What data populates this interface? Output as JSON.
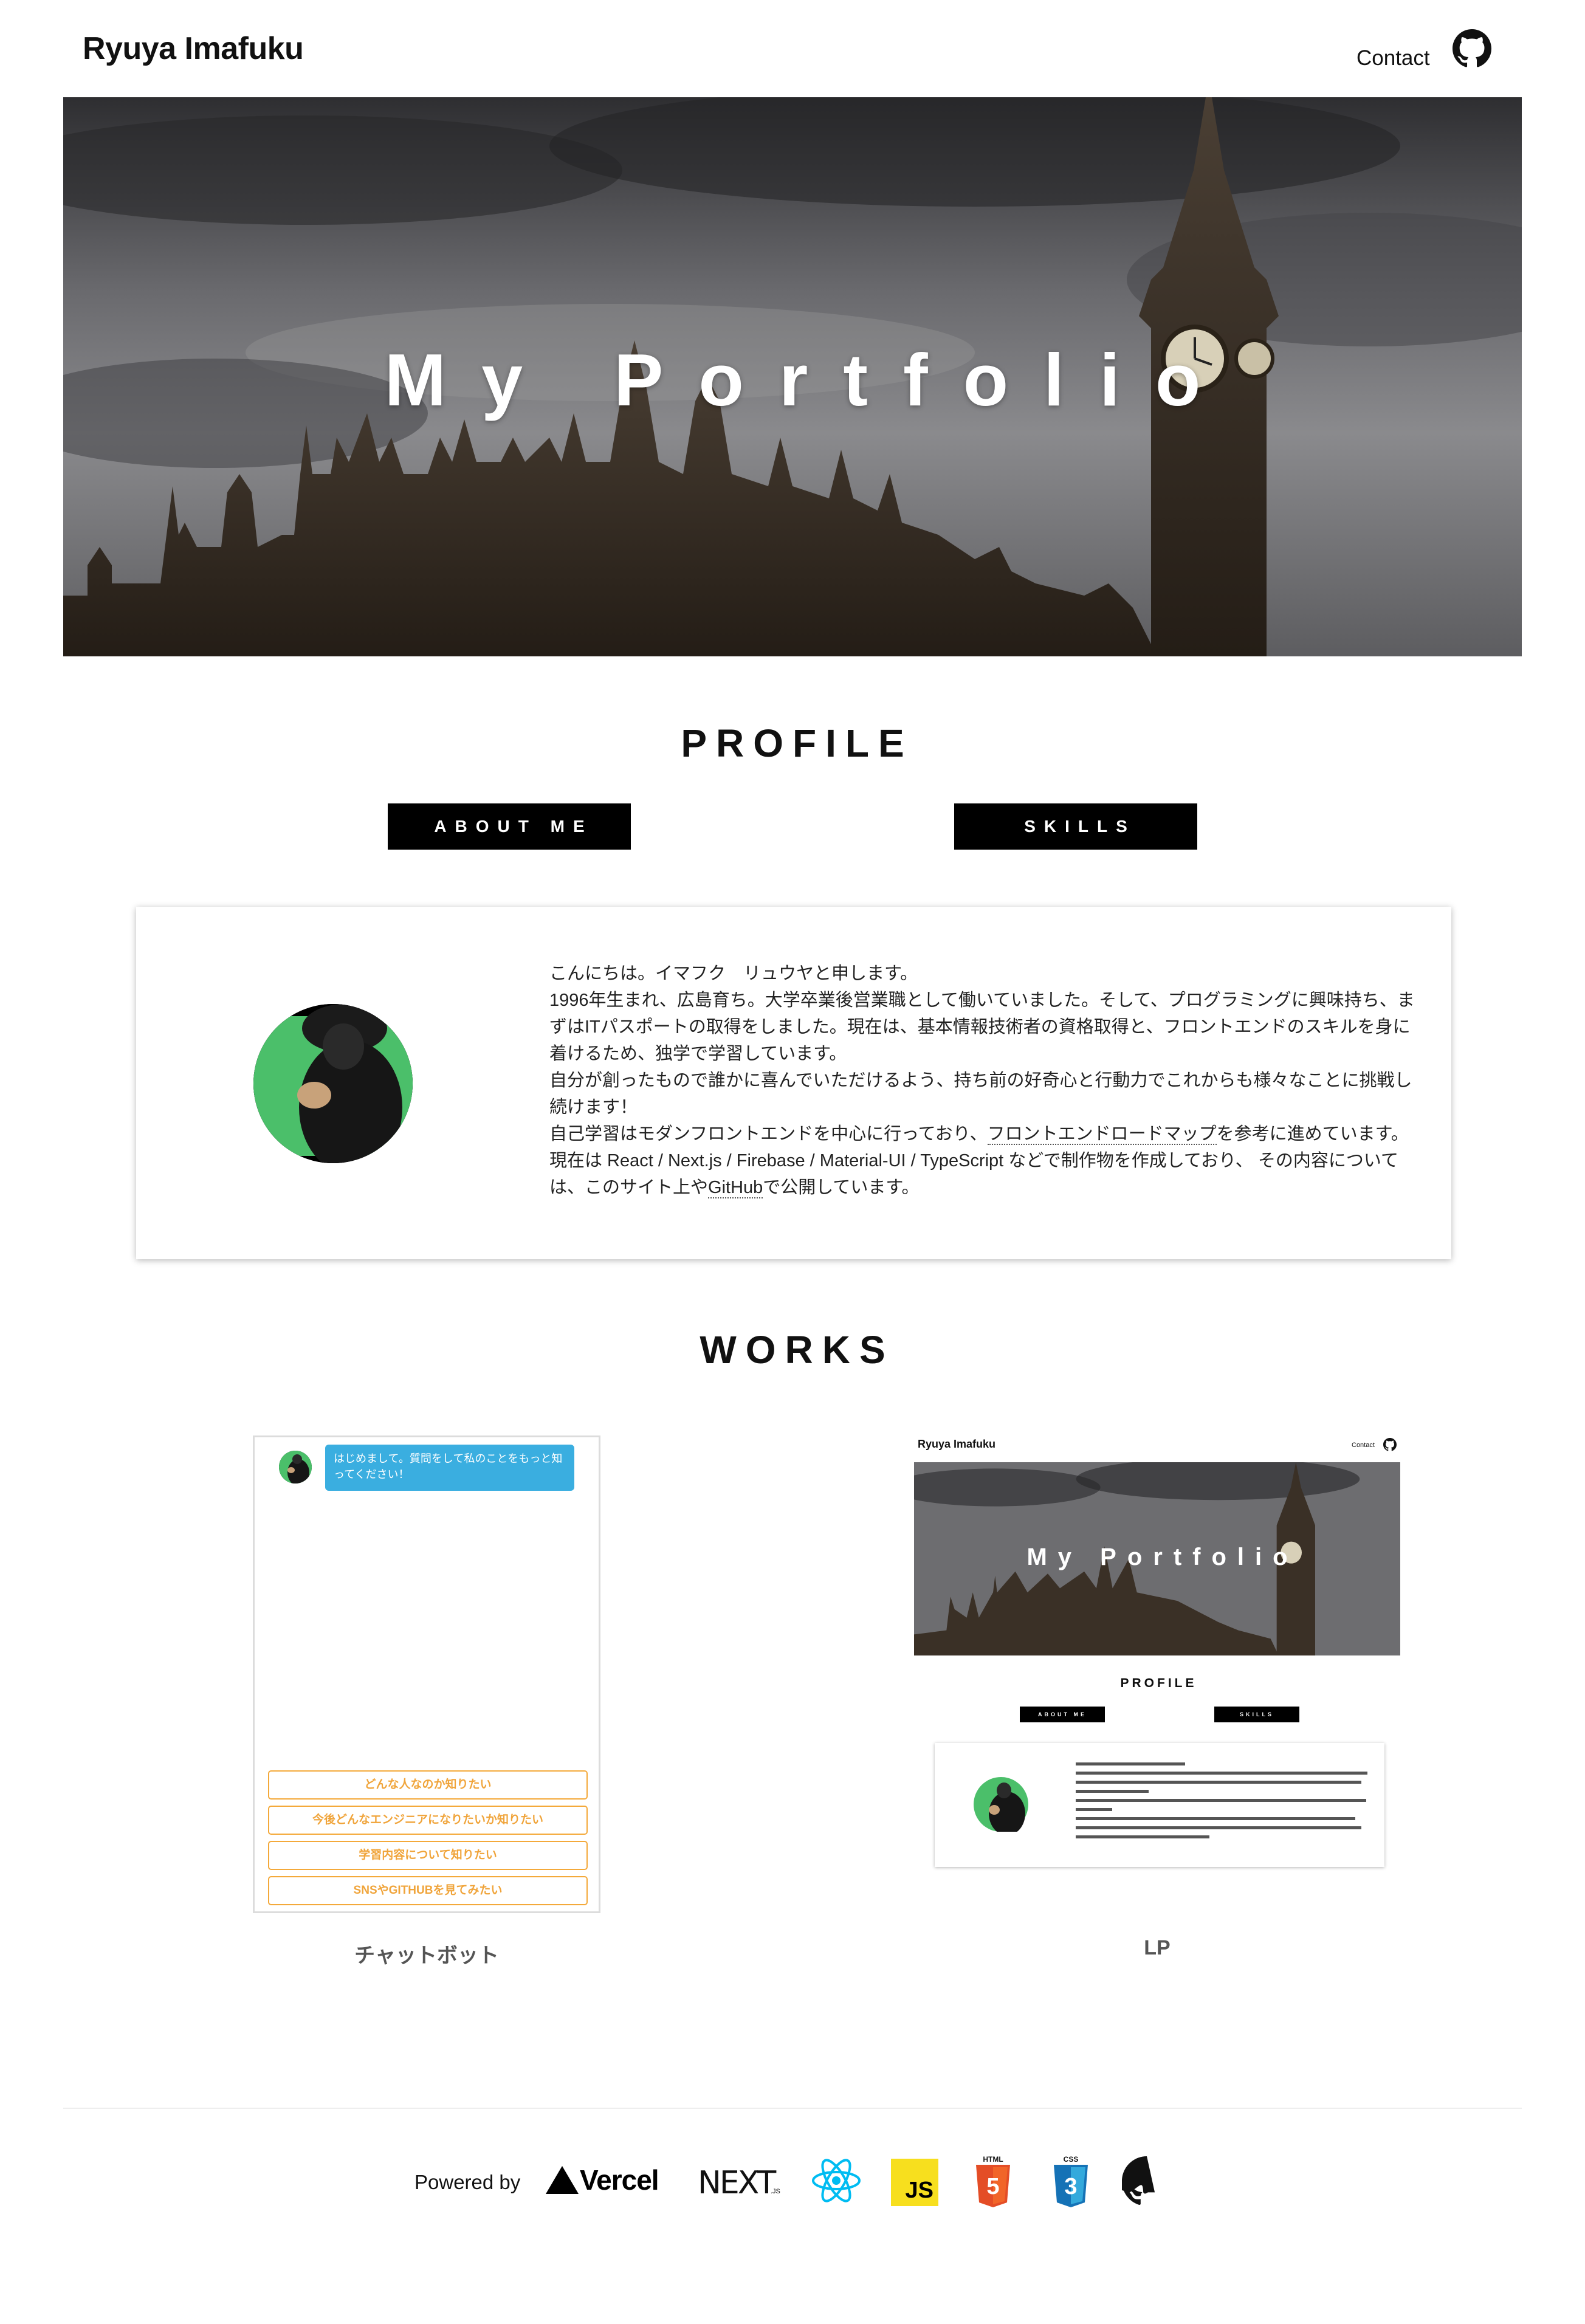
{
  "header": {
    "brand": "Ryuya Imafuku",
    "contact_label": "Contact",
    "github_icon": "github-icon"
  },
  "hero": {
    "title": "My Portfolio"
  },
  "profile": {
    "heading": "PROFILE",
    "tabs": [
      "ABOUT ME",
      "SKILLS"
    ],
    "about": {
      "line1": "こんにちは。イマフク　リュウヤと申します。",
      "line2": "1996年生まれ、広島育ち。大学卒業後営業職として働いていました。そして、プログラミングに興味持ち、まずはITパスポートの取得をしました。現在は、基本情報技術者の資格取得と、フロントエンドのスキルを身に着けるため、独学で学習しています。",
      "line3": "自分が創ったもので誰かに喜んでいただけるよう、持ち前の好奇心と行動力でこれからも様々なことに挑戦し続けます！",
      "line4_pre": "自己学習はモダンフロントエンドを中心に行っており、",
      "line4_link": "フロントエンドロードマップ",
      "line4_post": "を参考に進めています。",
      "line5_pre": "現在は React / Next.js / Firebase / Material-UI / TypeScript などで制作物を作成しており、 その内容については、このサイト上や",
      "line5_link": "GitHub",
      "line5_post": "で公開しています。"
    }
  },
  "works": {
    "heading": "WORKS",
    "items": [
      {
        "caption": "チャットボット",
        "bot_message": "はじめまして。質問をして私のことをもっと知ってください！",
        "options": [
          "どんな人なのか知りたい",
          "今後どんなエンジニアになりたいか知りたい",
          "学習内容について知りたい",
          "SNSやGITHUBを見てみたい"
        ]
      },
      {
        "caption": "LP",
        "thumb_brand": "Ryuya Imafuku",
        "thumb_contact": "Contact",
        "thumb_title": "My Portfolio",
        "thumb_heading": "PROFILE",
        "thumb_tabs": [
          "ABOUT ME",
          "SKILLS"
        ]
      }
    ]
  },
  "footer": {
    "powered_by": "Powered by",
    "vercel": "Vercel",
    "next": "NEXT",
    "next_suffix": ".JS",
    "js": "JS",
    "html": "HTML",
    "css": "CSS",
    "logos": [
      "vercel-logo",
      "nextjs-logo",
      "react-logo",
      "javascript-logo",
      "html5-logo",
      "css3-logo",
      "github-icon"
    ]
  },
  "colors": {
    "chat_bubble": "#3aaee0",
    "chat_option": "#f4a93a",
    "button_bg": "#000000"
  }
}
